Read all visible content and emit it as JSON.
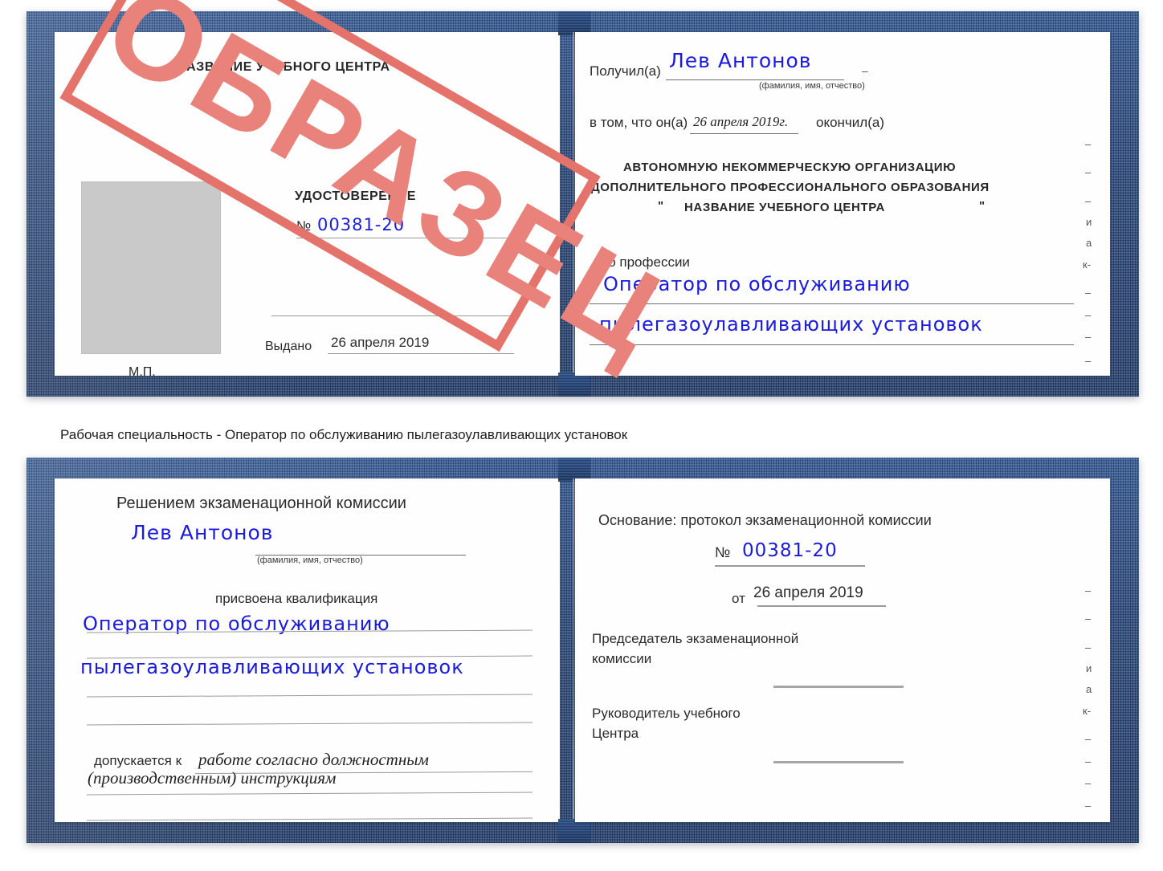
{
  "caption": "Рабочая специальность - Оператор по обслуживанию пылегазоулавливающих установок",
  "colors": {
    "cover_blue": "#26467c",
    "stamp_red": "#e4736c",
    "handwriting_blue": "#1a1ae0",
    "photo_placeholder_gray": "#c9c9c9"
  },
  "stamp": {
    "text": "ОБРАЗЕЦ"
  },
  "certificate_top": {
    "left_page": {
      "header": "НАЗВАНИЕ УЧЕБНОГО ЦЕНТРА",
      "title": "УДОСТОВЕРЕНИЕ",
      "number_label": "№",
      "number_value": "00381-20",
      "issued_label": "Выдано",
      "issued_value": "26 апреля 2019",
      "seal_label": "М.П."
    },
    "right_page": {
      "received_label": "Получил(а)",
      "received_value": "Лев Антонов",
      "fio_hint": "(фамилия, имя, отчество)",
      "that_he_label": "в том, что он(а)",
      "that_he_value": "26 апреля 2019г.",
      "finished_label": "окончил(а)",
      "org_line1": "АВТОНОМНУЮ НЕКОММЕРЧЕСКУЮ ОРГАНИЗАЦИЮ",
      "org_line2": "ДОПОЛНИТЕЛЬНОГО ПРОФЕССИОНАЛЬНОГО ОБРАЗОВАНИЯ",
      "org_quote_open": "\"",
      "org_line3": "НАЗВАНИЕ УЧЕБНОГО ЦЕНТРА",
      "org_quote_close": "\"",
      "profession_label": "по профессии",
      "profession_line1": "Оператор по обслуживанию",
      "profession_line2": "пылегазоулавливающих установок",
      "margin_fragments": [
        "–",
        "–",
        "–",
        "и",
        "а",
        "к-",
        "–",
        "–",
        "–",
        "–"
      ]
    }
  },
  "certificate_bottom": {
    "left_page": {
      "header": "Решением экзаменационной комиссии",
      "name_value": "Лев Антонов",
      "fio_hint": "(фамилия, имя, отчество)",
      "qualification_label": "присвоена квалификация",
      "qualification_line1": "Оператор по обслуживанию",
      "qualification_line2": "пылегазоулавливающих установок",
      "admitted_label": "допускается к",
      "admitted_line1": "работе согласно должностным",
      "admitted_line2": "(производственным) инструкциям"
    },
    "right_page": {
      "basis_label": "Основание: протокол экзаменационной комиссии",
      "number_label": "№",
      "number_value": "00381-20",
      "date_label": "от",
      "date_value": "26 апреля 2019",
      "chairman_line1": "Председатель экзаменационной",
      "chairman_line2": "комиссии",
      "head_line1": "Руководитель учебного",
      "head_line2": "Центра",
      "margin_fragments": [
        "–",
        "–",
        "–",
        "и",
        "а",
        "к-",
        "–",
        "–",
        "–",
        "–"
      ]
    }
  }
}
